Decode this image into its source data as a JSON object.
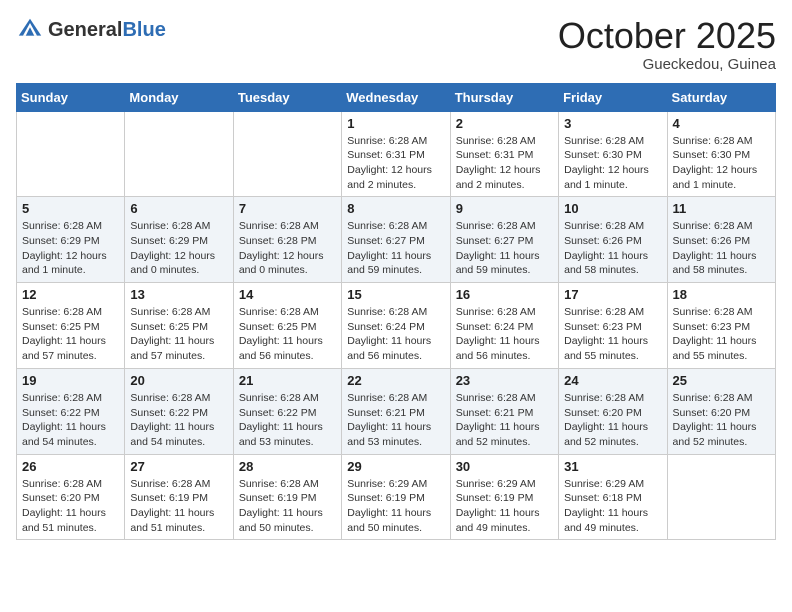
{
  "header": {
    "logo_general": "General",
    "logo_blue": "Blue",
    "month": "October 2025",
    "location": "Gueckedou, Guinea"
  },
  "weekdays": [
    "Sunday",
    "Monday",
    "Tuesday",
    "Wednesday",
    "Thursday",
    "Friday",
    "Saturday"
  ],
  "weeks": [
    [
      {
        "day": "",
        "sunrise": "",
        "sunset": "",
        "daylight": ""
      },
      {
        "day": "",
        "sunrise": "",
        "sunset": "",
        "daylight": ""
      },
      {
        "day": "",
        "sunrise": "",
        "sunset": "",
        "daylight": ""
      },
      {
        "day": "1",
        "sunrise": "Sunrise: 6:28 AM",
        "sunset": "Sunset: 6:31 PM",
        "daylight": "Daylight: 12 hours and 2 minutes."
      },
      {
        "day": "2",
        "sunrise": "Sunrise: 6:28 AM",
        "sunset": "Sunset: 6:31 PM",
        "daylight": "Daylight: 12 hours and 2 minutes."
      },
      {
        "day": "3",
        "sunrise": "Sunrise: 6:28 AM",
        "sunset": "Sunset: 6:30 PM",
        "daylight": "Daylight: 12 hours and 1 minute."
      },
      {
        "day": "4",
        "sunrise": "Sunrise: 6:28 AM",
        "sunset": "Sunset: 6:30 PM",
        "daylight": "Daylight: 12 hours and 1 minute."
      }
    ],
    [
      {
        "day": "5",
        "sunrise": "Sunrise: 6:28 AM",
        "sunset": "Sunset: 6:29 PM",
        "daylight": "Daylight: 12 hours and 1 minute."
      },
      {
        "day": "6",
        "sunrise": "Sunrise: 6:28 AM",
        "sunset": "Sunset: 6:29 PM",
        "daylight": "Daylight: 12 hours and 0 minutes."
      },
      {
        "day": "7",
        "sunrise": "Sunrise: 6:28 AM",
        "sunset": "Sunset: 6:28 PM",
        "daylight": "Daylight: 12 hours and 0 minutes."
      },
      {
        "day": "8",
        "sunrise": "Sunrise: 6:28 AM",
        "sunset": "Sunset: 6:27 PM",
        "daylight": "Daylight: 11 hours and 59 minutes."
      },
      {
        "day": "9",
        "sunrise": "Sunrise: 6:28 AM",
        "sunset": "Sunset: 6:27 PM",
        "daylight": "Daylight: 11 hours and 59 minutes."
      },
      {
        "day": "10",
        "sunrise": "Sunrise: 6:28 AM",
        "sunset": "Sunset: 6:26 PM",
        "daylight": "Daylight: 11 hours and 58 minutes."
      },
      {
        "day": "11",
        "sunrise": "Sunrise: 6:28 AM",
        "sunset": "Sunset: 6:26 PM",
        "daylight": "Daylight: 11 hours and 58 minutes."
      }
    ],
    [
      {
        "day": "12",
        "sunrise": "Sunrise: 6:28 AM",
        "sunset": "Sunset: 6:25 PM",
        "daylight": "Daylight: 11 hours and 57 minutes."
      },
      {
        "day": "13",
        "sunrise": "Sunrise: 6:28 AM",
        "sunset": "Sunset: 6:25 PM",
        "daylight": "Daylight: 11 hours and 57 minutes."
      },
      {
        "day": "14",
        "sunrise": "Sunrise: 6:28 AM",
        "sunset": "Sunset: 6:25 PM",
        "daylight": "Daylight: 11 hours and 56 minutes."
      },
      {
        "day": "15",
        "sunrise": "Sunrise: 6:28 AM",
        "sunset": "Sunset: 6:24 PM",
        "daylight": "Daylight: 11 hours and 56 minutes."
      },
      {
        "day": "16",
        "sunrise": "Sunrise: 6:28 AM",
        "sunset": "Sunset: 6:24 PM",
        "daylight": "Daylight: 11 hours and 56 minutes."
      },
      {
        "day": "17",
        "sunrise": "Sunrise: 6:28 AM",
        "sunset": "Sunset: 6:23 PM",
        "daylight": "Daylight: 11 hours and 55 minutes."
      },
      {
        "day": "18",
        "sunrise": "Sunrise: 6:28 AM",
        "sunset": "Sunset: 6:23 PM",
        "daylight": "Daylight: 11 hours and 55 minutes."
      }
    ],
    [
      {
        "day": "19",
        "sunrise": "Sunrise: 6:28 AM",
        "sunset": "Sunset: 6:22 PM",
        "daylight": "Daylight: 11 hours and 54 minutes."
      },
      {
        "day": "20",
        "sunrise": "Sunrise: 6:28 AM",
        "sunset": "Sunset: 6:22 PM",
        "daylight": "Daylight: 11 hours and 54 minutes."
      },
      {
        "day": "21",
        "sunrise": "Sunrise: 6:28 AM",
        "sunset": "Sunset: 6:22 PM",
        "daylight": "Daylight: 11 hours and 53 minutes."
      },
      {
        "day": "22",
        "sunrise": "Sunrise: 6:28 AM",
        "sunset": "Sunset: 6:21 PM",
        "daylight": "Daylight: 11 hours and 53 minutes."
      },
      {
        "day": "23",
        "sunrise": "Sunrise: 6:28 AM",
        "sunset": "Sunset: 6:21 PM",
        "daylight": "Daylight: 11 hours and 52 minutes."
      },
      {
        "day": "24",
        "sunrise": "Sunrise: 6:28 AM",
        "sunset": "Sunset: 6:20 PM",
        "daylight": "Daylight: 11 hours and 52 minutes."
      },
      {
        "day": "25",
        "sunrise": "Sunrise: 6:28 AM",
        "sunset": "Sunset: 6:20 PM",
        "daylight": "Daylight: 11 hours and 52 minutes."
      }
    ],
    [
      {
        "day": "26",
        "sunrise": "Sunrise: 6:28 AM",
        "sunset": "Sunset: 6:20 PM",
        "daylight": "Daylight: 11 hours and 51 minutes."
      },
      {
        "day": "27",
        "sunrise": "Sunrise: 6:28 AM",
        "sunset": "Sunset: 6:19 PM",
        "daylight": "Daylight: 11 hours and 51 minutes."
      },
      {
        "day": "28",
        "sunrise": "Sunrise: 6:28 AM",
        "sunset": "Sunset: 6:19 PM",
        "daylight": "Daylight: 11 hours and 50 minutes."
      },
      {
        "day": "29",
        "sunrise": "Sunrise: 6:29 AM",
        "sunset": "Sunset: 6:19 PM",
        "daylight": "Daylight: 11 hours and 50 minutes."
      },
      {
        "day": "30",
        "sunrise": "Sunrise: 6:29 AM",
        "sunset": "Sunset: 6:19 PM",
        "daylight": "Daylight: 11 hours and 49 minutes."
      },
      {
        "day": "31",
        "sunrise": "Sunrise: 6:29 AM",
        "sunset": "Sunset: 6:18 PM",
        "daylight": "Daylight: 11 hours and 49 minutes."
      },
      {
        "day": "",
        "sunrise": "",
        "sunset": "",
        "daylight": ""
      }
    ]
  ]
}
